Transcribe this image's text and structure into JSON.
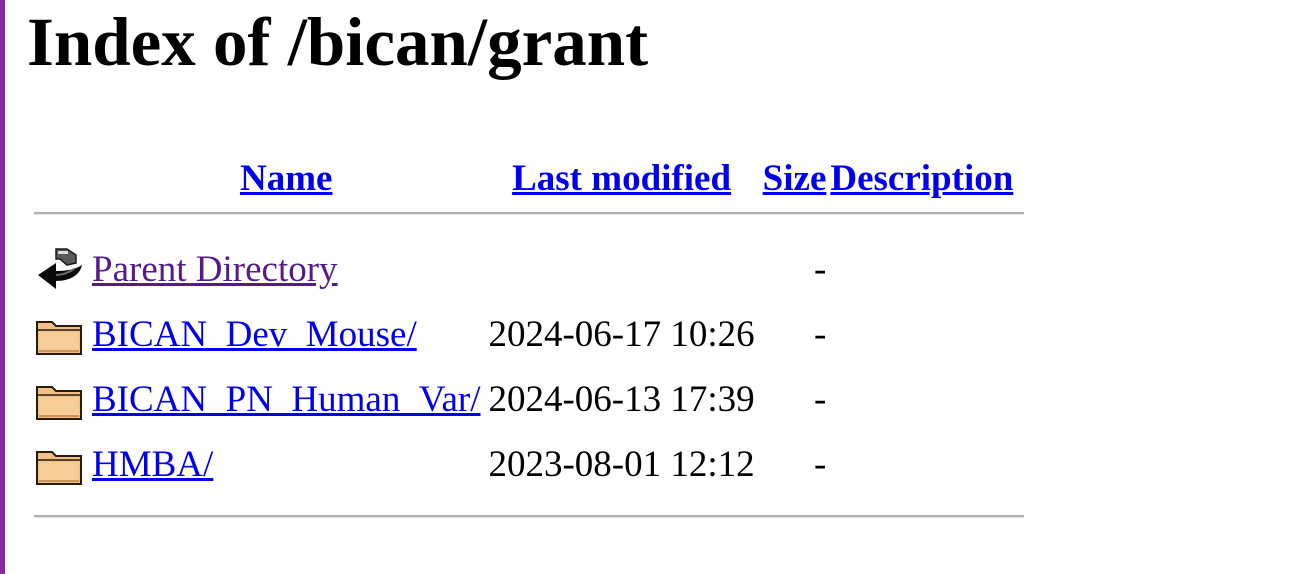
{
  "page": {
    "heading": "Index of /bican/grant",
    "accent_color": "#8e2aa1",
    "link_color": "#0000ee",
    "visited_link_color": "#551a8b"
  },
  "columns": {
    "name": "Name",
    "last_modified": "Last modified",
    "size": "Size",
    "description": "Description"
  },
  "entries": [
    {
      "icon": "back-icon",
      "name": "Parent Directory",
      "last_modified": "",
      "size": "-",
      "description": "",
      "visited": true
    },
    {
      "icon": "folder-icon",
      "name": "BICAN_Dev_Mouse/",
      "last_modified": "2024-06-17 10:26",
      "size": "-",
      "description": "",
      "visited": false
    },
    {
      "icon": "folder-icon",
      "name": "BICAN_PN_Human_Var/",
      "last_modified": "2024-06-13 17:39",
      "size": "-",
      "description": "",
      "visited": false
    },
    {
      "icon": "folder-icon",
      "name": "HMBA/",
      "last_modified": "2023-08-01 12:12",
      "size": "-",
      "description": "",
      "visited": false
    }
  ]
}
